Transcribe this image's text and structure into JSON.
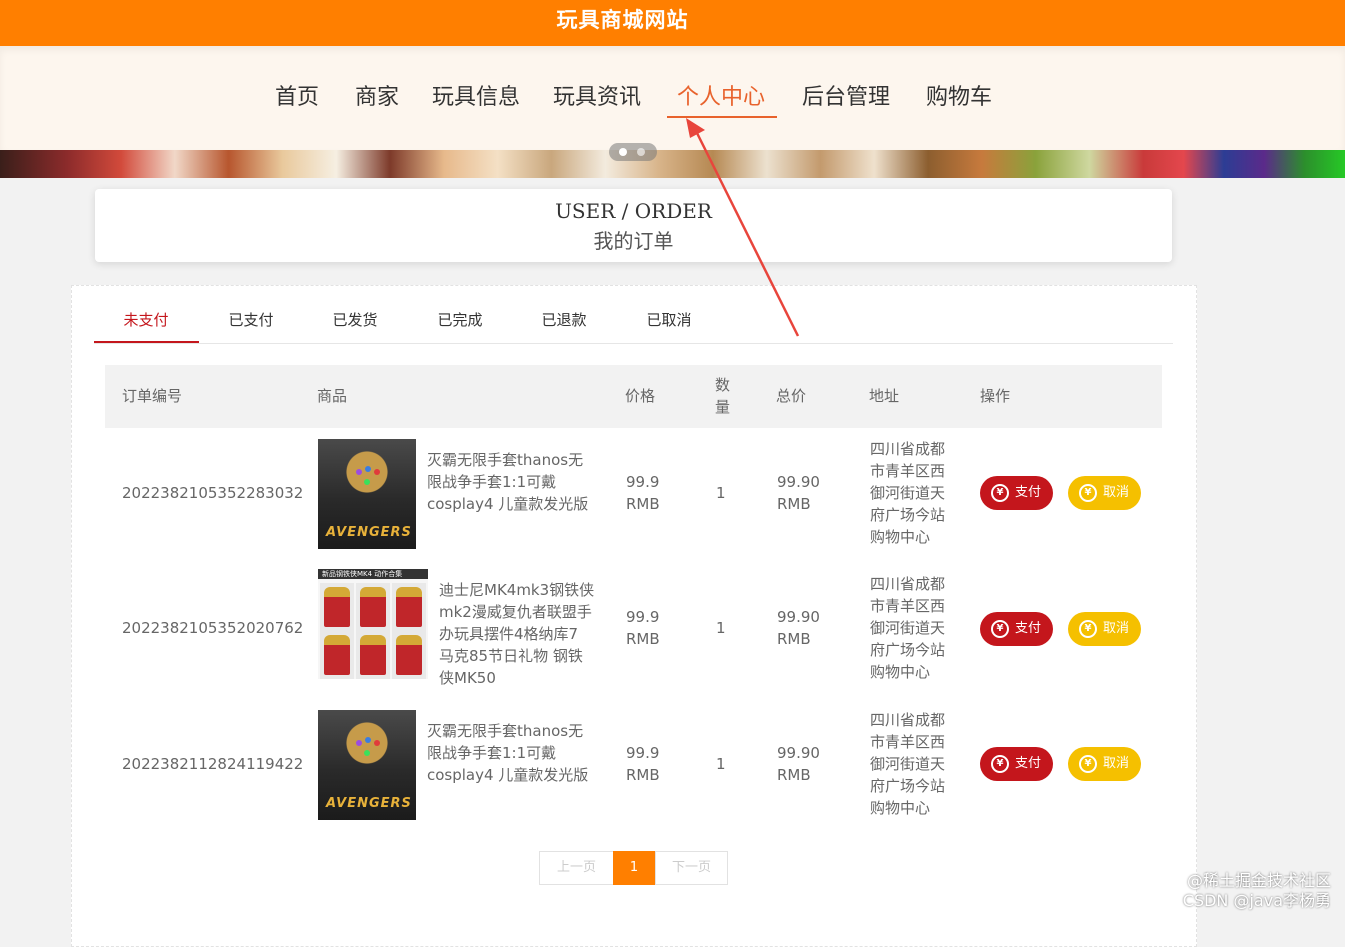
{
  "site": {
    "title": "玩具商城网站"
  },
  "nav": {
    "items": [
      "首页",
      "商家",
      "玩具信息",
      "玩具资讯",
      "个人中心",
      "后台管理",
      "购物车"
    ],
    "active_index": 4
  },
  "header": {
    "title_en": "USER / ORDER",
    "title_zh": "我的订单"
  },
  "tabs": {
    "items": [
      "未支付",
      "已支付",
      "已发货",
      "已完成",
      "已退款",
      "已取消"
    ],
    "active_index": 0
  },
  "table": {
    "columns": [
      "订单编号",
      "商品",
      "价格",
      "数量",
      "总价",
      "地址",
      "操作"
    ],
    "rows": [
      {
        "order_no": "2022382105352283032",
        "image": "avengers-gauntlet-image",
        "product_lines": [
          "灭霸无限手套thanos无",
          "限战争手套1:1可戴",
          "cosplay4 儿童款发光版"
        ],
        "price_lines": [
          "99.9",
          "RMB"
        ],
        "qty": "1",
        "total_lines": [
          "99.90",
          "RMB"
        ],
        "address_lines": [
          "四川省成都",
          "市青羊区西",
          "御河街道天",
          "府广场今站",
          "购物中心"
        ],
        "pay_label": "支付",
        "cancel_label": "取消"
      },
      {
        "order_no": "2022382105352020762",
        "image": "ironman-figures-image",
        "product_lines": [
          "迪士尼MK4mk3钢铁侠",
          "mk2漫威复仇者联盟手",
          "办玩具摆件4格纳库7",
          "马克85节日礼物 钢铁",
          "侠MK50"
        ],
        "price_lines": [
          "99.9",
          "RMB"
        ],
        "qty": "1",
        "total_lines": [
          "99.90",
          "RMB"
        ],
        "address_lines": [
          "四川省成都",
          "市青羊区西",
          "御河街道天",
          "府广场今站",
          "购物中心"
        ],
        "pay_label": "支付",
        "cancel_label": "取消"
      },
      {
        "order_no": "2022382112824119422",
        "image": "avengers-gauntlet-image",
        "product_lines": [
          "灭霸无限手套thanos无",
          "限战争手套1:1可戴",
          "cosplay4 儿童款发光版"
        ],
        "price_lines": [
          "99.9",
          "RMB"
        ],
        "qty": "1",
        "total_lines": [
          "99.90",
          "RMB"
        ],
        "address_lines": [
          "四川省成都",
          "市青羊区西",
          "御河街道天",
          "府广场今站",
          "购物中心"
        ],
        "pay_label": "支付",
        "cancel_label": "取消"
      }
    ]
  },
  "image_text": {
    "avengers_logo": "AVENGERS",
    "ironman_header": "新品钢铁侠MK4 动作合集"
  },
  "pagination": {
    "prev": "上一页",
    "current": "1",
    "next": "下一页"
  },
  "watermark": {
    "line1": "@稀土掘金技术社区",
    "line2": "CSDN @java李杨勇"
  },
  "colors": {
    "brand": "#ff7f00",
    "accent": "#e8622c",
    "pay": "#c4161c",
    "cancel": "#f5c000"
  },
  "icons": {
    "pay": "yen-coin-icon",
    "cancel": "yen-coin-icon",
    "annotation": "red-arrow"
  }
}
